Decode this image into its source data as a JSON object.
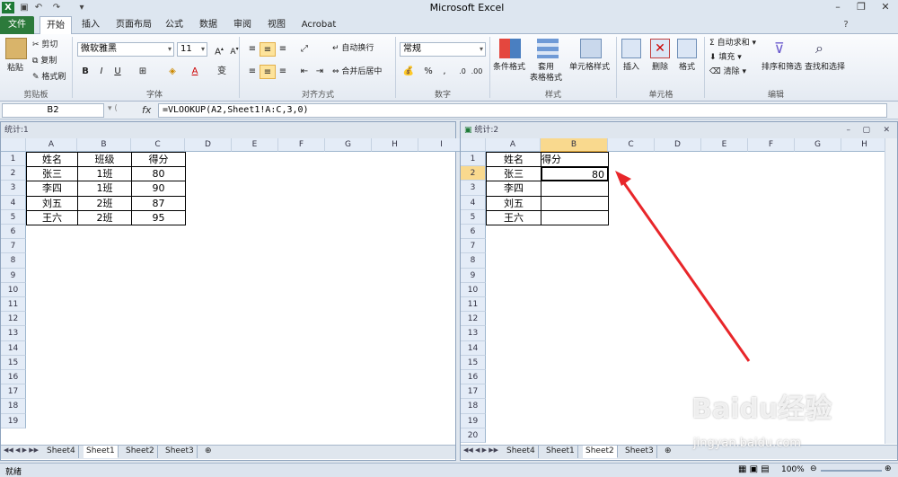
{
  "app": {
    "title": "Microsoft Excel"
  },
  "ribbon": {
    "tabs": [
      "文件",
      "开始",
      "插入",
      "页面布局",
      "公式",
      "数据",
      "审阅",
      "视图",
      "Acrobat"
    ],
    "clipboard": {
      "paste": "粘贴",
      "cut": "剪切",
      "copy": "复制",
      "format_painter": "格式刷",
      "label": "剪贴板"
    },
    "font": {
      "name": "微软雅黑",
      "size": "11",
      "bold": "B",
      "italic": "I",
      "underline": "U",
      "label": "字体"
    },
    "align": {
      "wrap": "自动换行",
      "merge": "合并后居中",
      "label": "对齐方式"
    },
    "number": {
      "format": "常规",
      "percent": "%",
      "comma": ",",
      "label": "数字"
    },
    "styles": {
      "cond": "条件格式",
      "table1": "套用",
      "table2": "表格格式",
      "cell": "单元格样式",
      "label": "样式"
    },
    "cells": {
      "insert": "插入",
      "delete": "删除",
      "format": "格式",
      "label": "单元格"
    },
    "editing": {
      "autosum": "自动求和",
      "fill": "填充",
      "clear": "清除",
      "sort": "排序和筛选",
      "find": "查找和选择",
      "label": "编辑"
    }
  },
  "formula_bar": {
    "name_box": "B2",
    "fx": "fx",
    "formula": "=VLOOKUP(A2,Sheet1!A:C,3,0)"
  },
  "win1": {
    "title": "统计:1",
    "columns": [
      "A",
      "B",
      "C",
      "D",
      "E",
      "F",
      "G",
      "H",
      "I"
    ],
    "rows": [
      "1",
      "2",
      "3",
      "4",
      "5",
      "6",
      "7",
      "8",
      "9",
      "10",
      "11",
      "12",
      "13",
      "14",
      "15",
      "16",
      "17",
      "18",
      "19"
    ],
    "table": [
      [
        "姓名",
        "班级",
        "得分"
      ],
      [
        "张三",
        "1班",
        "80"
      ],
      [
        "李四",
        "1班",
        "90"
      ],
      [
        "刘五",
        "2班",
        "87"
      ],
      [
        "王六",
        "2班",
        "95"
      ]
    ],
    "sheets": [
      "Sheet4",
      "Sheet1",
      "Sheet2",
      "Sheet3"
    ],
    "active_sheet": "Sheet1"
  },
  "win2": {
    "title": "统计:2",
    "columns": [
      "A",
      "B",
      "C",
      "D",
      "E",
      "F",
      "G",
      "H"
    ],
    "rows": [
      "1",
      "2",
      "3",
      "4",
      "5",
      "6",
      "7",
      "8",
      "9",
      "10",
      "11",
      "12",
      "13",
      "14",
      "15",
      "16",
      "17",
      "18",
      "19",
      "20"
    ],
    "table": [
      [
        "姓名",
        "得分"
      ],
      [
        "张三",
        "80"
      ],
      [
        "李四",
        ""
      ],
      [
        "刘五",
        ""
      ],
      [
        "王六",
        ""
      ]
    ],
    "sheets": [
      "Sheet4",
      "Sheet1",
      "Sheet2",
      "Sheet3"
    ],
    "active_sheet": "Sheet2",
    "active_cell": "B2"
  },
  "statusbar": {
    "ready": "就绪",
    "zoom": "100%"
  },
  "watermark": {
    "text": "Baidu经验",
    "url": "jingyan.baidu.com"
  },
  "colors": {
    "file_tab": "#2c7a3b",
    "selected_header": "#f9d98e",
    "arrow": "#e8262a"
  }
}
